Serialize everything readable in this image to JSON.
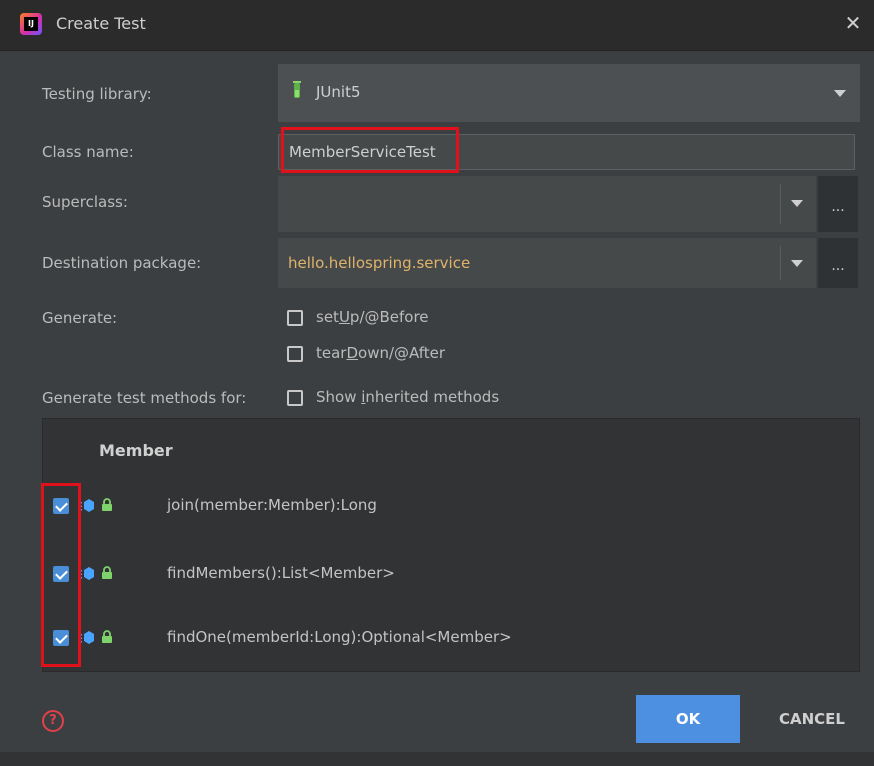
{
  "window": {
    "title": "Create Test"
  },
  "form": {
    "testing_library_label": "Testing library:",
    "testing_library_value": "JUnit5",
    "class_name_label": "Class name:",
    "class_name_value": "MemberServiceTest",
    "superclass_label": "Superclass:",
    "superclass_value": "",
    "browse_label": "...",
    "destination_label": "Destination package:",
    "destination_value": "hello.hellospring.service",
    "generate_label": "Generate:",
    "generate_options": [
      {
        "pre": "set",
        "mnemonic": "U",
        "post": "p/@Before",
        "checked": false
      },
      {
        "pre": "tear",
        "mnemonic": "D",
        "post": "own/@After",
        "checked": false
      }
    ],
    "generate_methods_label": "Generate test methods for:",
    "show_inherited": {
      "pre": "Show ",
      "mnemonic": "i",
      "post": "nherited methods",
      "checked": false
    }
  },
  "members": {
    "header": "Member",
    "items": [
      {
        "signature": "join(member:Member):Long",
        "checked": true
      },
      {
        "signature": "findMembers():List<Member>",
        "checked": true
      },
      {
        "signature": "findOne(memberId:Long):Optional<Member>",
        "checked": true
      }
    ]
  },
  "footer": {
    "help_glyph": "?",
    "ok_label": "OK",
    "cancel_label": "CANCEL"
  },
  "colors": {
    "accent": "#4d8fe0",
    "highlight_box": "#e0111b",
    "package_text": "#e0b36b",
    "icon_blue": "#4aa3ff",
    "lock_green": "#7fd36b"
  },
  "icons": {
    "app": "intellij-idea-icon",
    "close": "close-icon",
    "library": "flask-icon",
    "method": "method-icon",
    "visibility": "lock-icon",
    "help": "help-icon"
  },
  "window_buttons": {
    "close_glyph": "✕"
  },
  "app_icon_text": "IJ"
}
